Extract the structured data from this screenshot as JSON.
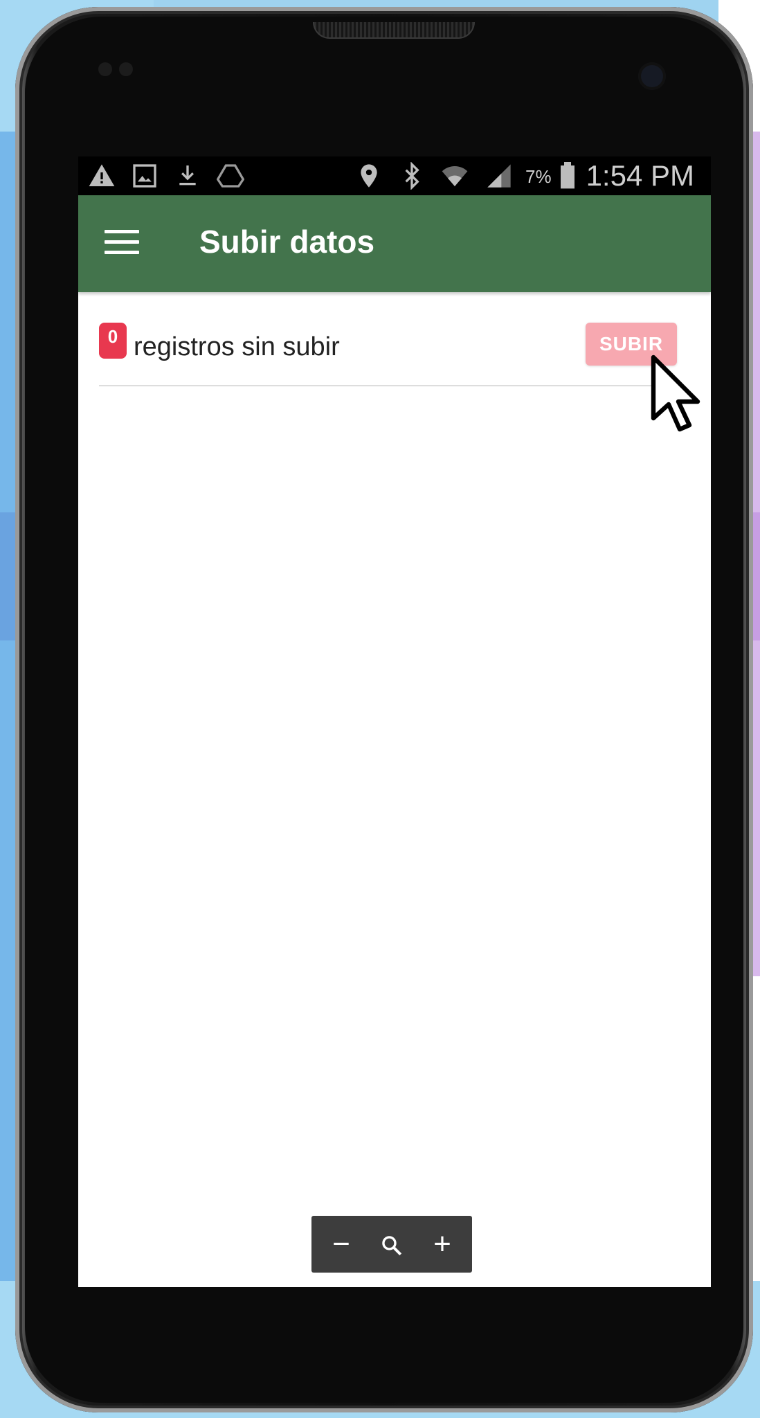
{
  "status_bar": {
    "icons": [
      "warning-icon",
      "image-icon",
      "download-icon",
      "drive-icon",
      "location-icon",
      "bluetooth-icon",
      "wifi-icon",
      "signal-icon",
      "battery-icon"
    ],
    "battery_percent": "7%",
    "time": "1:54 PM"
  },
  "app_bar": {
    "title": "Subir datos",
    "menu_icon": "hamburger-menu-icon",
    "color": "#43744c"
  },
  "upload_row": {
    "count": "0",
    "text": "registros sin subir",
    "button_label": "SUBIR",
    "badge_color": "#e8384f",
    "button_color": "#f7a8b0"
  },
  "zoom_controls": {
    "minus": "−",
    "zoom": "zoom-icon",
    "plus": "+"
  }
}
